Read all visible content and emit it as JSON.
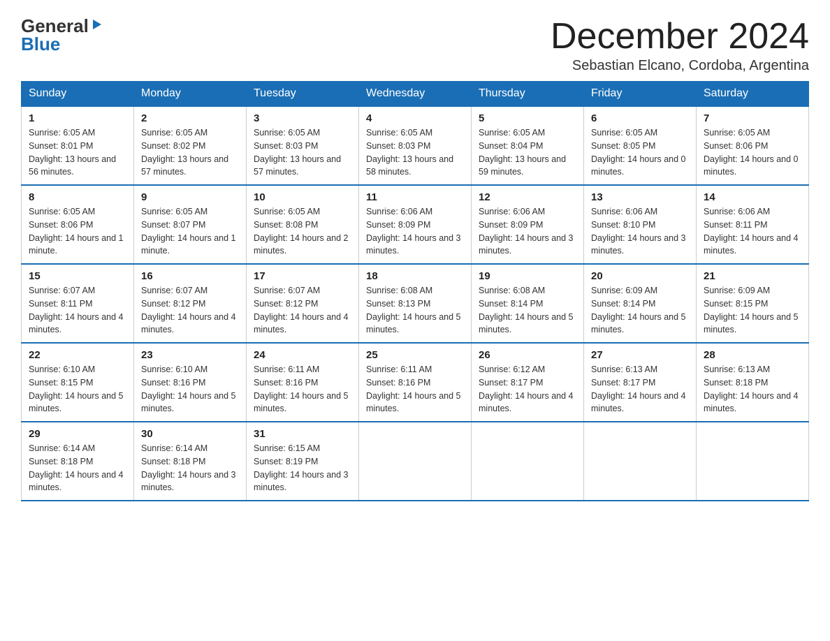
{
  "header": {
    "logo_general": "General",
    "logo_blue": "Blue",
    "month_title": "December 2024",
    "location": "Sebastian Elcano, Cordoba, Argentina"
  },
  "days_of_week": [
    "Sunday",
    "Monday",
    "Tuesday",
    "Wednesday",
    "Thursday",
    "Friday",
    "Saturday"
  ],
  "weeks": [
    [
      {
        "day": "1",
        "sunrise": "6:05 AM",
        "sunset": "8:01 PM",
        "daylight": "13 hours and 56 minutes."
      },
      {
        "day": "2",
        "sunrise": "6:05 AM",
        "sunset": "8:02 PM",
        "daylight": "13 hours and 57 minutes."
      },
      {
        "day": "3",
        "sunrise": "6:05 AM",
        "sunset": "8:03 PM",
        "daylight": "13 hours and 57 minutes."
      },
      {
        "day": "4",
        "sunrise": "6:05 AM",
        "sunset": "8:03 PM",
        "daylight": "13 hours and 58 minutes."
      },
      {
        "day": "5",
        "sunrise": "6:05 AM",
        "sunset": "8:04 PM",
        "daylight": "13 hours and 59 minutes."
      },
      {
        "day": "6",
        "sunrise": "6:05 AM",
        "sunset": "8:05 PM",
        "daylight": "14 hours and 0 minutes."
      },
      {
        "day": "7",
        "sunrise": "6:05 AM",
        "sunset": "8:06 PM",
        "daylight": "14 hours and 0 minutes."
      }
    ],
    [
      {
        "day": "8",
        "sunrise": "6:05 AM",
        "sunset": "8:06 PM",
        "daylight": "14 hours and 1 minute."
      },
      {
        "day": "9",
        "sunrise": "6:05 AM",
        "sunset": "8:07 PM",
        "daylight": "14 hours and 1 minute."
      },
      {
        "day": "10",
        "sunrise": "6:05 AM",
        "sunset": "8:08 PM",
        "daylight": "14 hours and 2 minutes."
      },
      {
        "day": "11",
        "sunrise": "6:06 AM",
        "sunset": "8:09 PM",
        "daylight": "14 hours and 3 minutes."
      },
      {
        "day": "12",
        "sunrise": "6:06 AM",
        "sunset": "8:09 PM",
        "daylight": "14 hours and 3 minutes."
      },
      {
        "day": "13",
        "sunrise": "6:06 AM",
        "sunset": "8:10 PM",
        "daylight": "14 hours and 3 minutes."
      },
      {
        "day": "14",
        "sunrise": "6:06 AM",
        "sunset": "8:11 PM",
        "daylight": "14 hours and 4 minutes."
      }
    ],
    [
      {
        "day": "15",
        "sunrise": "6:07 AM",
        "sunset": "8:11 PM",
        "daylight": "14 hours and 4 minutes."
      },
      {
        "day": "16",
        "sunrise": "6:07 AM",
        "sunset": "8:12 PM",
        "daylight": "14 hours and 4 minutes."
      },
      {
        "day": "17",
        "sunrise": "6:07 AM",
        "sunset": "8:12 PM",
        "daylight": "14 hours and 4 minutes."
      },
      {
        "day": "18",
        "sunrise": "6:08 AM",
        "sunset": "8:13 PM",
        "daylight": "14 hours and 5 minutes."
      },
      {
        "day": "19",
        "sunrise": "6:08 AM",
        "sunset": "8:14 PM",
        "daylight": "14 hours and 5 minutes."
      },
      {
        "day": "20",
        "sunrise": "6:09 AM",
        "sunset": "8:14 PM",
        "daylight": "14 hours and 5 minutes."
      },
      {
        "day": "21",
        "sunrise": "6:09 AM",
        "sunset": "8:15 PM",
        "daylight": "14 hours and 5 minutes."
      }
    ],
    [
      {
        "day": "22",
        "sunrise": "6:10 AM",
        "sunset": "8:15 PM",
        "daylight": "14 hours and 5 minutes."
      },
      {
        "day": "23",
        "sunrise": "6:10 AM",
        "sunset": "8:16 PM",
        "daylight": "14 hours and 5 minutes."
      },
      {
        "day": "24",
        "sunrise": "6:11 AM",
        "sunset": "8:16 PM",
        "daylight": "14 hours and 5 minutes."
      },
      {
        "day": "25",
        "sunrise": "6:11 AM",
        "sunset": "8:16 PM",
        "daylight": "14 hours and 5 minutes."
      },
      {
        "day": "26",
        "sunrise": "6:12 AM",
        "sunset": "8:17 PM",
        "daylight": "14 hours and 4 minutes."
      },
      {
        "day": "27",
        "sunrise": "6:13 AM",
        "sunset": "8:17 PM",
        "daylight": "14 hours and 4 minutes."
      },
      {
        "day": "28",
        "sunrise": "6:13 AM",
        "sunset": "8:18 PM",
        "daylight": "14 hours and 4 minutes."
      }
    ],
    [
      {
        "day": "29",
        "sunrise": "6:14 AM",
        "sunset": "8:18 PM",
        "daylight": "14 hours and 4 minutes."
      },
      {
        "day": "30",
        "sunrise": "6:14 AM",
        "sunset": "8:18 PM",
        "daylight": "14 hours and 3 minutes."
      },
      {
        "day": "31",
        "sunrise": "6:15 AM",
        "sunset": "8:19 PM",
        "daylight": "14 hours and 3 minutes."
      },
      null,
      null,
      null,
      null
    ]
  ],
  "labels": {
    "sunrise": "Sunrise:",
    "sunset": "Sunset:",
    "daylight": "Daylight:"
  }
}
